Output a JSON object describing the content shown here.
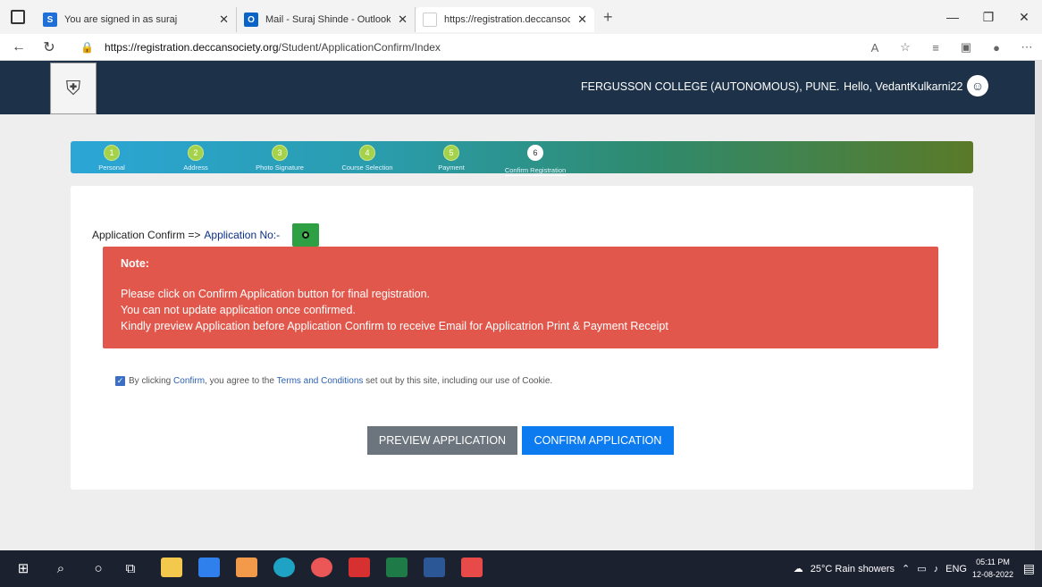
{
  "browser": {
    "tabs": [
      {
        "icon": "S",
        "icon_color": "#1e6fd6",
        "label": "You are signed in as suraj"
      },
      {
        "icon": "O",
        "icon_color": "#0a64c7",
        "label": "Mail - Suraj Shinde - Outlook"
      },
      {
        "icon": "",
        "icon_color": "#ffffff",
        "label": "https://registration.deccansociet"
      }
    ],
    "new_tab": "+",
    "url_domain": "https://registration.deccansociety.org",
    "url_path": "/Student/ApplicationConfirm/Index"
  },
  "header": {
    "college": "FERGUSSON COLLEGE (AUTONOMOUS), PUNE.",
    "greeting": "Hello, VedantKulkarni22"
  },
  "steps": [
    {
      "num": "1",
      "label": "Personal"
    },
    {
      "num": "2",
      "label": "Address"
    },
    {
      "num": "3",
      "label": "Photo Signature"
    },
    {
      "num": "4",
      "label": "Course Selection"
    },
    {
      "num": "5",
      "label": "Payment"
    },
    {
      "num": "6",
      "label": "Confirm Registration"
    }
  ],
  "application": {
    "prefix": "Application Confirm =>",
    "number_label": "Application No:-"
  },
  "note": {
    "title": "Note:",
    "lines": [
      "Please click on Confirm Application button for final registration.",
      "You can not update application once confirmed.",
      "Kindly preview Application before Application Confirm to receive Email for Applicatrion Print & Payment Receipt"
    ]
  },
  "agree": {
    "t1": "By clicking",
    "confirm": "Confirm",
    "t2": ", you agree to the",
    "terms": "Terms and Conditions",
    "t3": "set out by this site, including our use of Cookie."
  },
  "buttons": {
    "preview": "PREVIEW APPLICATION",
    "confirm": "CONFIRM APPLICATION"
  },
  "taskbar": {
    "weather": "25°C  Rain showers",
    "lang": "ENG",
    "time": "05:11 PM",
    "date": "12-08-2022"
  }
}
